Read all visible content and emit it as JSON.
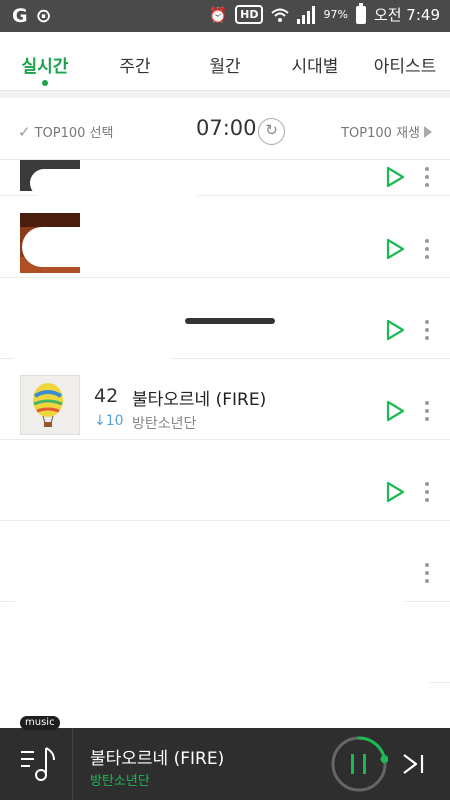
{
  "status_bar": {
    "battery": "97%",
    "clock": "오전 7:49",
    "icons": [
      "carrier-g-icon",
      "notification-circle-icon",
      "alarm-icon",
      "hd-voice-icon",
      "wifi-icon",
      "signal-icon",
      "battery-icon"
    ],
    "hd_label": "HD"
  },
  "tabs": [
    {
      "label": "실시간",
      "active": true
    },
    {
      "label": "주간",
      "active": false
    },
    {
      "label": "월간",
      "active": false
    },
    {
      "label": "시대별",
      "active": false
    },
    {
      "label": "아티스트",
      "active": false
    }
  ],
  "toolbar": {
    "select_label": "TOP100 선택",
    "time": "07:00",
    "play_all_label": "TOP100 재생"
  },
  "chart_rows": [
    {
      "rank": "",
      "change": "",
      "title": "",
      "artist": "",
      "redacted": true
    },
    {
      "rank": "",
      "change": "",
      "title": "",
      "artist": "",
      "redacted": true
    },
    {
      "rank": "",
      "change": "",
      "title": "",
      "artist": "",
      "redacted": true
    },
    {
      "rank": "42",
      "change": "↓10",
      "title": "불타오르네 (FIRE)",
      "artist": "방탄소년단",
      "redacted": false
    },
    {
      "rank": "",
      "change": "",
      "title": "",
      "artist": "",
      "redacted": true
    },
    {
      "rank": "",
      "change": "",
      "title": "",
      "artist": "",
      "redacted": true
    },
    {
      "rank": "",
      "change": "",
      "title": "",
      "artist": "",
      "redacted": true
    }
  ],
  "player": {
    "tag": "music",
    "title": "불타오르네 (FIRE)",
    "artist": "방탄소년단",
    "progress": 0.22
  },
  "colors": {
    "accent": "#1aa34a",
    "player_bg": "#2e2e2e",
    "artist_green": "#1db954"
  }
}
